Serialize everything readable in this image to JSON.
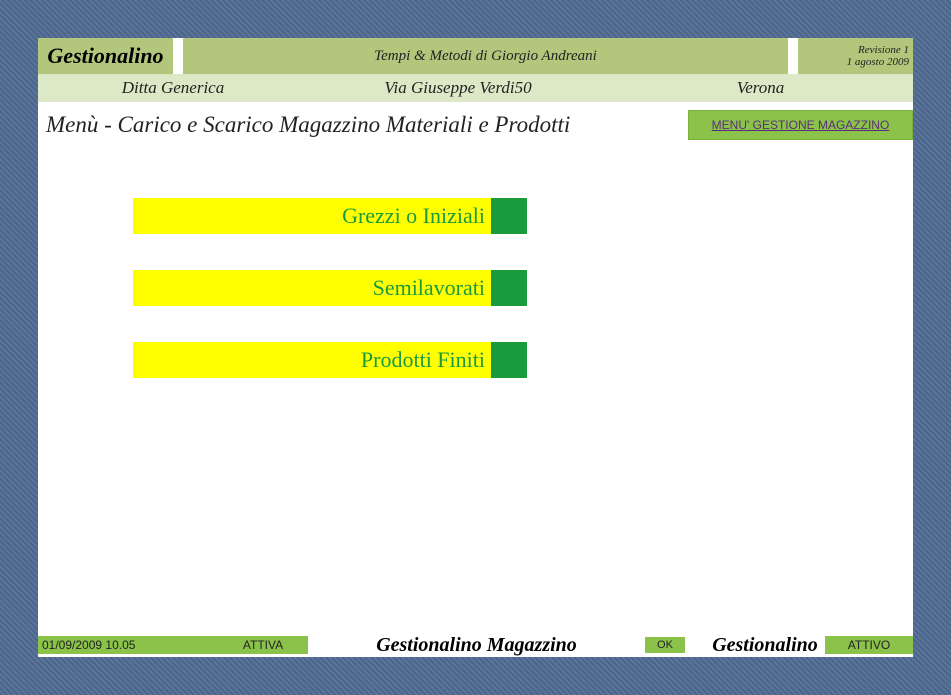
{
  "header": {
    "brand": "Gestionalino",
    "subtitle": "Tempi & Metodi di Giorgio Andreani",
    "revision_label": "Revisione   1",
    "revision_date": "1 agosto 2009"
  },
  "company": {
    "name": "Ditta Generica",
    "address": "Via Giuseppe Verdi50",
    "city": "Verona"
  },
  "menu": {
    "title": "Menù - Carico e Scarico Magazzino Materiali e Prodotti",
    "link_label": "MENU' GESTIONE MAGAZZINO"
  },
  "buttons": [
    {
      "label": "Grezzi o Iniziali"
    },
    {
      "label": "Semilavorati"
    },
    {
      "label": "Prodotti Finiti"
    }
  ],
  "footer": {
    "datetime": "01/09/2009 10.05",
    "status1": "ATTIVA",
    "center_text": "Gestionalino Magazzino",
    "ok": "OK",
    "brand2": "Gestionalino",
    "status2": "ATTIVO"
  }
}
